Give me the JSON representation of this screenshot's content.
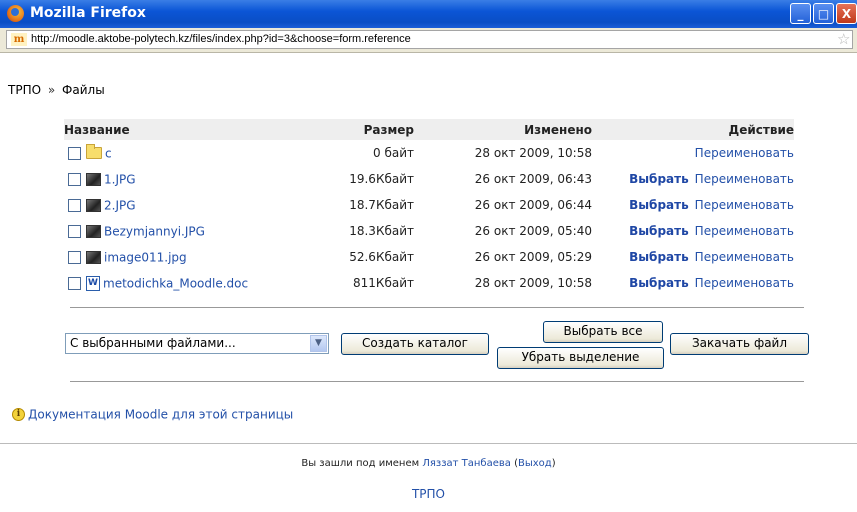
{
  "window": {
    "title": "Mozilla Firefox",
    "minimize": "_",
    "maximize": "□",
    "close": "X"
  },
  "addressbar": {
    "site_icon": "m",
    "url": "http://moodle.aktobe-polytech.kz/files/index.php?id=3&choose=form.reference",
    "star": "☆"
  },
  "breadcrumb": {
    "root": "ТРПО",
    "separator": "»",
    "current": "Файлы"
  },
  "table": {
    "headers": {
      "name": "Название",
      "size": "Размер",
      "modified": "Изменено",
      "action": "Действие"
    },
    "rows": [
      {
        "icon": "folder-icon",
        "name": "c",
        "size": "0 байт",
        "modified": "28 окт 2009, 10:58",
        "select": "",
        "rename": "Переименовать"
      },
      {
        "icon": "image-icon",
        "name": "1.JPG",
        "size": "19.6Кбайт",
        "modified": "26 окт 2009, 06:43",
        "select": "Выбрать",
        "rename": "Переименовать"
      },
      {
        "icon": "image-icon",
        "name": "2.JPG",
        "size": "18.7Кбайт",
        "modified": "26 окт 2009, 06:44",
        "select": "Выбрать",
        "rename": "Переименовать"
      },
      {
        "icon": "image-icon",
        "name": "Bezymjannyi.JPG",
        "size": "18.3Кбайт",
        "modified": "26 окт 2009, 05:40",
        "select": "Выбрать",
        "rename": "Переименовать"
      },
      {
        "icon": "image-icon",
        "name": "image011.jpg",
        "size": "52.6Кбайт",
        "modified": "26 окт 2009, 05:29",
        "select": "Выбрать",
        "rename": "Переименовать"
      },
      {
        "icon": "word-doc-icon",
        "name": "metodichka_Moodle.doc",
        "size": "811Кбайт",
        "modified": "28 окт 2009, 10:58",
        "select": "Выбрать",
        "rename": "Переименовать"
      }
    ]
  },
  "controls": {
    "with_selected": "С выбранными файлами...",
    "dropdown_arrow": "▼",
    "create_folder": "Создать каталог",
    "select_all": "Выбрать все",
    "deselect": "Убрать выделение",
    "upload": "Закачать файл"
  },
  "docs": {
    "info_icon": "i",
    "link": "Документация Moodle для этой страницы"
  },
  "footer": {
    "logged_in_as": "Вы зашли под именем",
    "user": "Ляззат Танбаева",
    "open_paren": " (",
    "logout": "Выход",
    "close_paren": ")",
    "home": "ТРПО"
  }
}
